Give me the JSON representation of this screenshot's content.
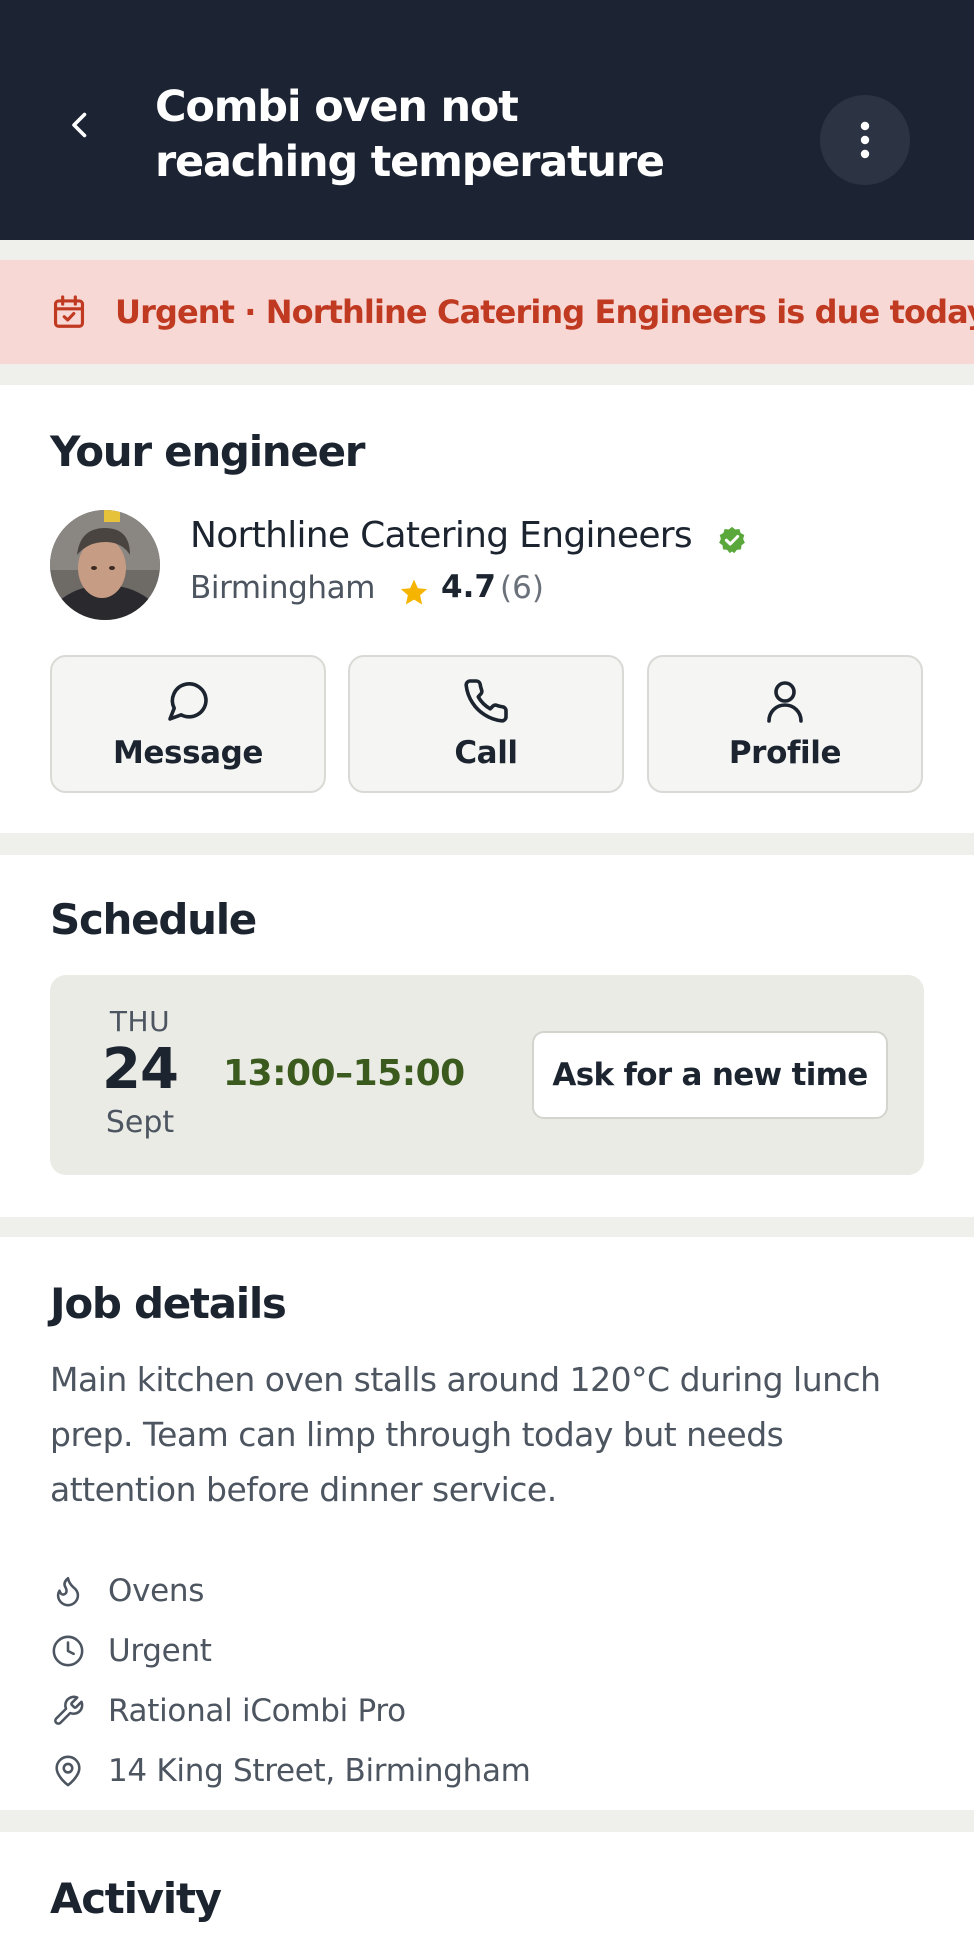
{
  "header": {
    "title": "Combi oven not reaching temperature",
    "back_icon": "chevron-left-icon",
    "more_icon": "more-vertical-icon"
  },
  "banner": {
    "icon": "calendar-check-icon",
    "text": "Urgent · Northline Catering Engineers is due today",
    "color": "#c03a22",
    "background": "#f8d8d4"
  },
  "engineer": {
    "heading": "Your engineer",
    "name": "Northline Catering Engineers",
    "verified": true,
    "location": "Birmingham",
    "rating": "4.7",
    "rating_count": "(6)",
    "actions": [
      {
        "label": "Message",
        "icon": "message-circle-icon"
      },
      {
        "label": "Call",
        "icon": "phone-icon"
      },
      {
        "label": "Profile",
        "icon": "user-icon"
      }
    ]
  },
  "schedule": {
    "heading": "Schedule",
    "day": "THU",
    "date": "24",
    "month": "Sept",
    "time": "13:00–15:00",
    "new_time_label": "Ask for a new time"
  },
  "job": {
    "heading": "Job details",
    "description": "Main kitchen oven stalls around 120°C during lunch prep. Team can limp through today but needs attention before dinner service.",
    "details": [
      {
        "icon": "flame-icon",
        "text": "Ovens"
      },
      {
        "icon": "clock-icon",
        "text": "Urgent"
      },
      {
        "icon": "wrench-icon",
        "text": "Rational iCombi Pro"
      },
      {
        "icon": "map-pin-icon",
        "text": "14 King Street, Birmingham"
      }
    ]
  },
  "activity": {
    "heading": "Activity"
  },
  "colors": {
    "header_bg": "#1c2433",
    "verified": "#5aa83c",
    "star": "#f4b400",
    "time_green": "#3b5a1e"
  }
}
